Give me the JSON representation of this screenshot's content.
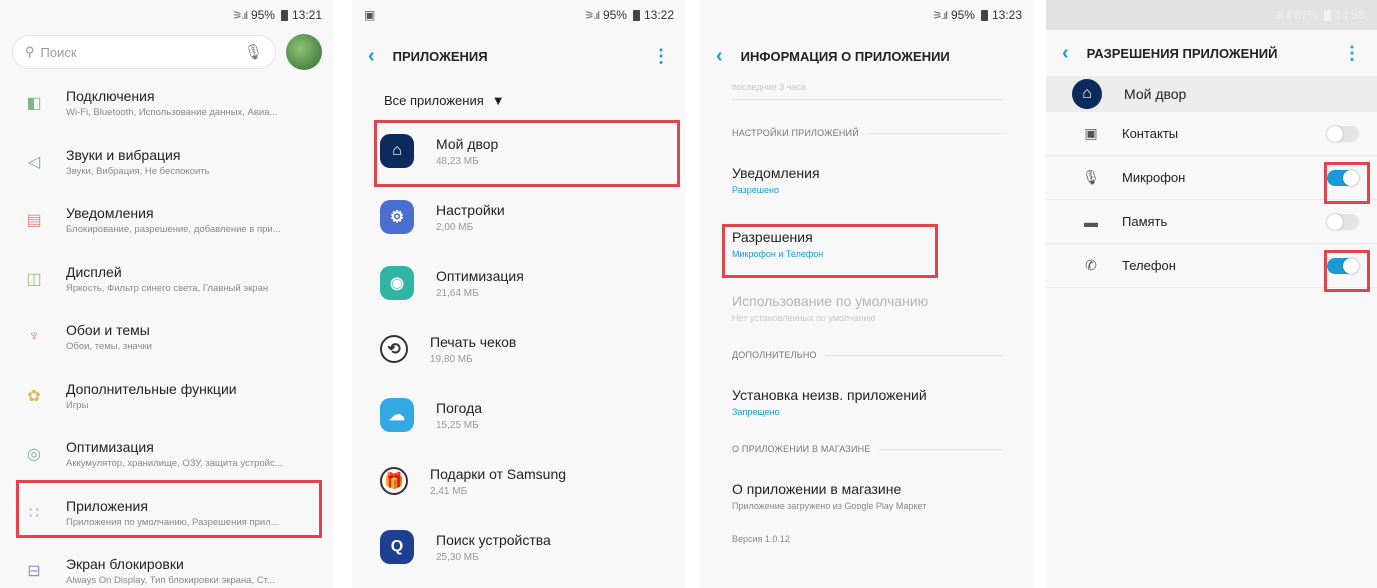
{
  "panel1": {
    "status": {
      "signal": "⚞.ıl",
      "battery": "95%",
      "time": "13:21"
    },
    "search": {
      "placeholder": "Поиск"
    },
    "items": [
      {
        "title": "Подключения",
        "subtitle": "Wi-Fi, Bluetooth, Использование данных, Авиа...",
        "icon": "connections-icon",
        "glyph": "◧",
        "color": "#7fb98a"
      },
      {
        "title": "Звуки и вибрация",
        "subtitle": "Звуки, Вибрация, Не беспокоить",
        "icon": "speaker-icon",
        "glyph": "◁",
        "color": "#8a97b8"
      },
      {
        "title": "Уведомления",
        "subtitle": "Блокирование, разрешение, добавление в при...",
        "icon": "notifications-icon",
        "glyph": "▤",
        "color": "#e38b80"
      },
      {
        "title": "Дисплей",
        "subtitle": "Яркость, Фильтр синего света, Главный экран",
        "icon": "display-icon",
        "glyph": "◫",
        "color": "#9bc17a"
      },
      {
        "title": "Обои и темы",
        "subtitle": "Обои, темы, значки",
        "icon": "brush-icon",
        "glyph": "♆",
        "color": "#c486c4"
      },
      {
        "title": "Дополнительные функции",
        "subtitle": "Игры",
        "icon": "gear-plus-icon",
        "glyph": "✿",
        "color": "#e2b85a"
      },
      {
        "title": "Оптимизация",
        "subtitle": "Аккумулятор, хранилище, ОЗУ, защита устройс...",
        "icon": "optimization-icon",
        "glyph": "◎",
        "color": "#72b99e"
      },
      {
        "title": "Приложения",
        "subtitle": "Приложения по умолчанию, Разрешения прил...",
        "icon": "apps-icon",
        "glyph": "∷",
        "color": "#6fb8d4"
      },
      {
        "title": "Экран блокировки",
        "subtitle": "Always On Display, Тип блокировки экрана, Ст...",
        "icon": "lock-screen-icon",
        "glyph": "⊟",
        "color": "#8f8fc5"
      }
    ]
  },
  "panel2": {
    "status": {
      "signal": "⚞.ıl",
      "battery": "95%",
      "time": "13:22"
    },
    "title": "ПРИЛОЖЕНИЯ",
    "filter": "Все приложения",
    "apps": [
      {
        "name": "Мой двор",
        "size": "48,23 МБ",
        "icon": "house-icon",
        "glyph": "⌂",
        "bg": "#0d2a5c"
      },
      {
        "name": "Настройки",
        "size": "2,00 МБ",
        "icon": "settings-gear-icon",
        "glyph": "⚙",
        "bg": "#4a6fd1"
      },
      {
        "name": "Оптимизация",
        "size": "21,64 МБ",
        "icon": "optimization-app-icon",
        "glyph": "◉",
        "bg": "#2fb5a2"
      },
      {
        "name": "Печать чеков",
        "size": "19,80 МБ",
        "icon": "receipt-print-icon",
        "glyph": "⟲",
        "bg": "#ffffff"
      },
      {
        "name": "Погода",
        "size": "15,25 МБ",
        "icon": "weather-icon",
        "glyph": "☁",
        "bg": "#33a8e3"
      },
      {
        "name": "Подарки от Samsung",
        "size": "2,41 МБ",
        "icon": "gift-icon",
        "glyph": "🎁",
        "bg": "#ffffff"
      },
      {
        "name": "Поиск устройства",
        "size": "25,30 МБ",
        "icon": "find-device-icon",
        "glyph": "Q",
        "bg": "#1d3f8f"
      }
    ]
  },
  "panel3": {
    "status": {
      "signal": "⚞.ıl",
      "battery": "95%",
      "time": "13:23"
    },
    "title": "ИНФОРМАЦИЯ О ПРИЛОЖЕНИИ",
    "cut_text": "последние 3 часа",
    "sections": {
      "app_settings": "НАСТРОЙКИ ПРИЛОЖЕНИЙ",
      "additional": "ДОПОЛНИТЕЛЬНО",
      "store": "О ПРИЛОЖЕНИИ В МАГАЗИНЕ"
    },
    "rows": {
      "notifications": {
        "title": "Уведомления",
        "sub": "Разрешено"
      },
      "permissions": {
        "title": "Разрешения",
        "sub": "Микрофон и Телефон"
      },
      "defaults": {
        "title": "Использование по умолчанию",
        "sub": "Нет установленных по умолчанию"
      },
      "unknown": {
        "title": "Установка неизв. приложений",
        "sub": "Запрещено"
      },
      "about": {
        "title": "О приложении в магазине",
        "sub": "Приложение загружено из Google Play Маркет"
      },
      "version": "Версия 1.0.12"
    }
  },
  "panel4": {
    "status": {
      "signal": "⚞.ıl",
      "battery": "87%",
      "time": "14:58"
    },
    "title": "РАЗРЕШЕНИЯ ПРИЛОЖЕНИЙ",
    "app_name": "Мой двор",
    "permissions": [
      {
        "name": "Контакты",
        "icon": "contacts-icon",
        "glyph": "▣",
        "enabled": false
      },
      {
        "name": "Микрофон",
        "icon": "microphone-icon",
        "glyph": "🎙",
        "enabled": true
      },
      {
        "name": "Память",
        "icon": "folder-icon",
        "glyph": "▬",
        "enabled": false
      },
      {
        "name": "Телефон",
        "icon": "phone-icon",
        "glyph": "✆",
        "enabled": true
      }
    ],
    "toggle_on_color": "#1a9bd7",
    "highlight_color": "#e0444d"
  }
}
